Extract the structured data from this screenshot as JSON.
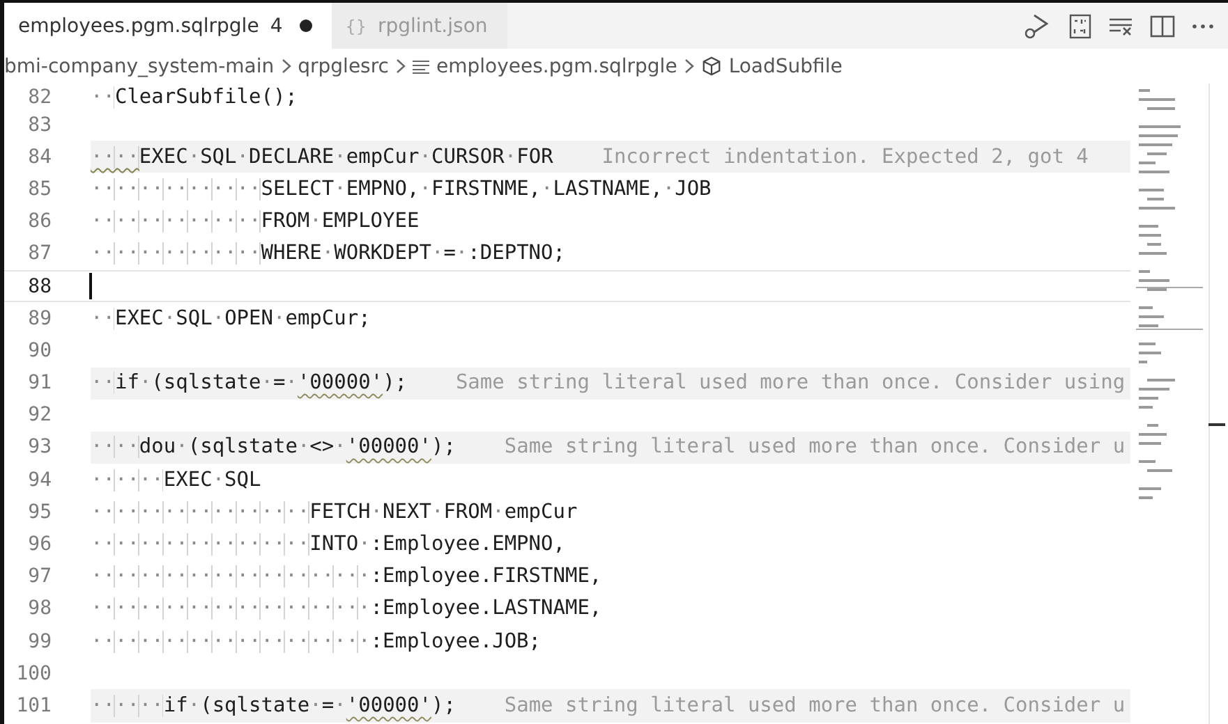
{
  "tabs": [
    {
      "label": "employees.pgm.sqlrpgle",
      "problems": "4",
      "modified": true,
      "selected": true
    },
    {
      "icon_text": "{}",
      "label": "rpglint.json",
      "modified": false,
      "selected": false
    }
  ],
  "breadcrumb": [
    {
      "label": "bmi-company_system-main",
      "kind": "folder"
    },
    {
      "label": "qrpglesrc",
      "kind": "folder"
    },
    {
      "label": "employees.pgm.sqlrpgle",
      "kind": "file"
    },
    {
      "label": "LoadSubfile",
      "kind": "symbol"
    }
  ],
  "lines": [
    {
      "number": "82",
      "current": false,
      "segments": [
        {
          "text": "··ClearSubfile();",
          "squiggle": false
        }
      ]
    },
    {
      "number": "83",
      "current": false
    },
    {
      "number": "84",
      "current": false,
      "segments": [
        {
          "text": "····",
          "squiggle": true
        },
        {
          "text": "EXEC·SQL·DECLARE·empCur·CURSOR·FOR",
          "squiggle": false
        }
      ],
      "diagnostic": "Incorrect indentation. Expected 2, got 4"
    },
    {
      "number": "85",
      "current": false,
      "segments": [
        {
          "text": "··············SELECT·EMPNO,·FIRSTNME,·LASTNAME,·JOB",
          "squiggle": false
        }
      ]
    },
    {
      "number": "86",
      "current": false,
      "segments": [
        {
          "text": "··············FROM·EMPLOYEE",
          "squiggle": false
        }
      ]
    },
    {
      "number": "87",
      "current": false,
      "segments": [
        {
          "text": "··············WHERE·WORKDEPT·=·:DEPTNO;",
          "squiggle": false
        }
      ]
    },
    {
      "number": "88",
      "current": true
    },
    {
      "number": "89",
      "current": false,
      "segments": [
        {
          "text": "··EXEC·SQL·OPEN·empCur;",
          "squiggle": false
        }
      ]
    },
    {
      "number": "90",
      "current": false
    },
    {
      "number": "91",
      "current": false,
      "segments": [
        {
          "text": "··if·(sqlstate·=·",
          "squiggle": false
        },
        {
          "text": "'00000'",
          "squiggle": true
        },
        {
          "text": ");",
          "squiggle": false
        }
      ],
      "diagnostic": "Same string literal used more than once. Consider using"
    },
    {
      "number": "92",
      "current": false
    },
    {
      "number": "93",
      "current": false,
      "segments": [
        {
          "text": "····dou·(sqlstate·<>·",
          "squiggle": false
        },
        {
          "text": "'00000'",
          "squiggle": true
        },
        {
          "text": ");",
          "squiggle": false
        }
      ],
      "diagnostic": "Same string literal used more than once. Consider u"
    },
    {
      "number": "94",
      "current": false,
      "segments": [
        {
          "text": "······EXEC·SQL",
          "squiggle": false
        }
      ]
    },
    {
      "number": "95",
      "current": false,
      "segments": [
        {
          "text": "··················FETCH·NEXT·FROM·empCur",
          "squiggle": false
        }
      ]
    },
    {
      "number": "96",
      "current": false,
      "segments": [
        {
          "text": "··················INTO·:Employee.EMPNO,",
          "squiggle": false
        }
      ]
    },
    {
      "number": "97",
      "current": false,
      "segments": [
        {
          "text": "·······················:Employee.FIRSTNME,",
          "squiggle": false
        }
      ]
    },
    {
      "number": "98",
      "current": false,
      "segments": [
        {
          "text": "·······················:Employee.LASTNAME,",
          "squiggle": false
        }
      ]
    },
    {
      "number": "99",
      "current": false,
      "segments": [
        {
          "text": "·······················:Employee.JOB;",
          "squiggle": false
        }
      ]
    },
    {
      "number": "100",
      "current": false
    },
    {
      "number": "101",
      "current": false,
      "segments": [
        {
          "text": "······if·(sqlstate·=·",
          "squiggle": false
        },
        {
          "text": "'00000'",
          "squiggle": true
        },
        {
          "text": ");",
          "squiggle": false
        }
      ],
      "diagnostic": "Same string literal used more than once. Consider u"
    }
  ]
}
